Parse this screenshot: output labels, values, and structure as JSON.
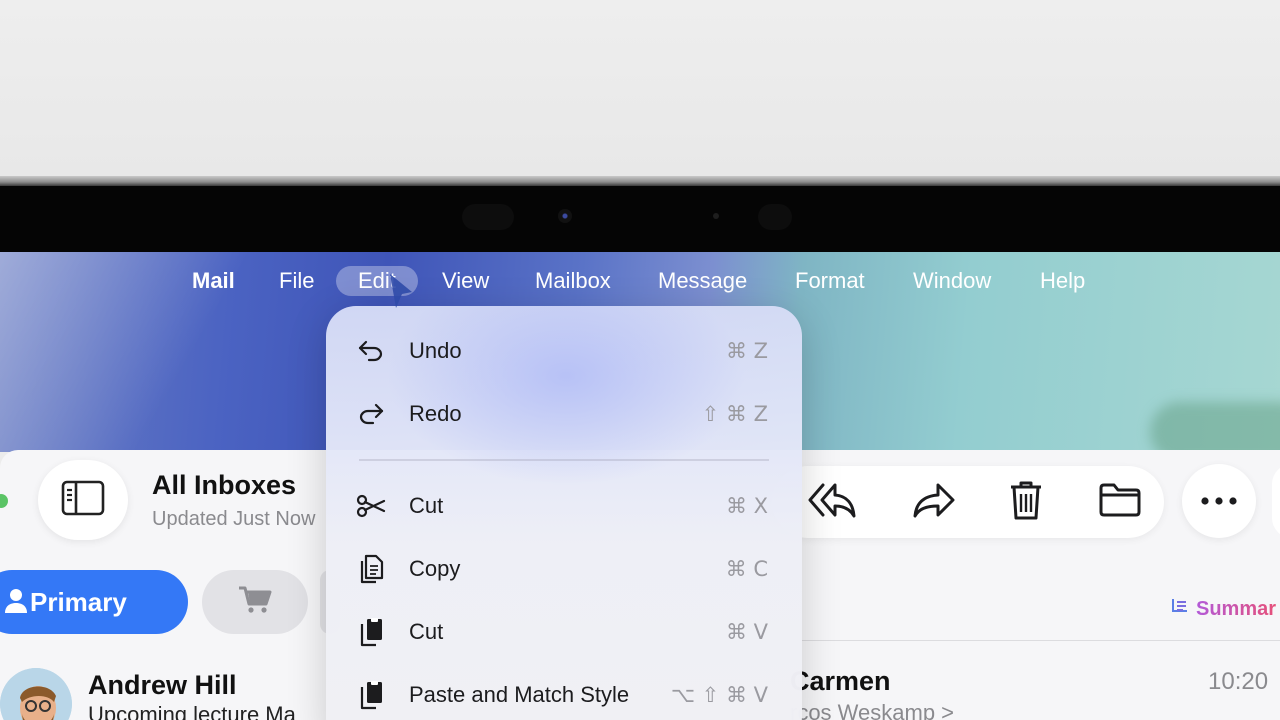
{
  "menubar": {
    "app": "Mail",
    "items": [
      "File",
      "Edit",
      "View",
      "Mailbox",
      "Message",
      "Format",
      "Window",
      "Help"
    ],
    "active": "Edit"
  },
  "edit_menu": {
    "items": [
      {
        "label": "Undo",
        "shortcut": "⌘ Z",
        "icon": "undo-arrow-icon"
      },
      {
        "label": "Redo",
        "shortcut": "⇧ ⌘ Z",
        "icon": "redo-arrow-icon"
      },
      {
        "label": "Cut",
        "shortcut": "⌘ X",
        "icon": "scissors-icon"
      },
      {
        "label": "Copy",
        "shortcut": "⌘ C",
        "icon": "copy-documents-icon"
      },
      {
        "label": "Cut",
        "shortcut": "⌘ V",
        "icon": "clipboard-icon"
      },
      {
        "label": "Paste and Match Style",
        "shortcut": "⌥ ⇧ ⌘ V",
        "icon": "clipboard-icon"
      }
    ]
  },
  "mailbox": {
    "title": "All Inboxes",
    "subtitle": "Updated Just Now",
    "tabs": {
      "primary": "Primary"
    },
    "summary": "Summar"
  },
  "messages": [
    {
      "sender": "Andrew Hill",
      "preview": "Upcoming lecture Ma"
    },
    {
      "sender": "Carmen",
      "to": "rcos Weskamp >",
      "time": "10:20"
    }
  ],
  "toolbar": {
    "icons": [
      "reply-all-icon",
      "forward-icon",
      "trash-icon",
      "folder-icon",
      "more-icon"
    ]
  },
  "colors": {
    "accent": "#3478f6",
    "summary_gradient": [
      "#b25ad8",
      "#e6507a"
    ]
  }
}
